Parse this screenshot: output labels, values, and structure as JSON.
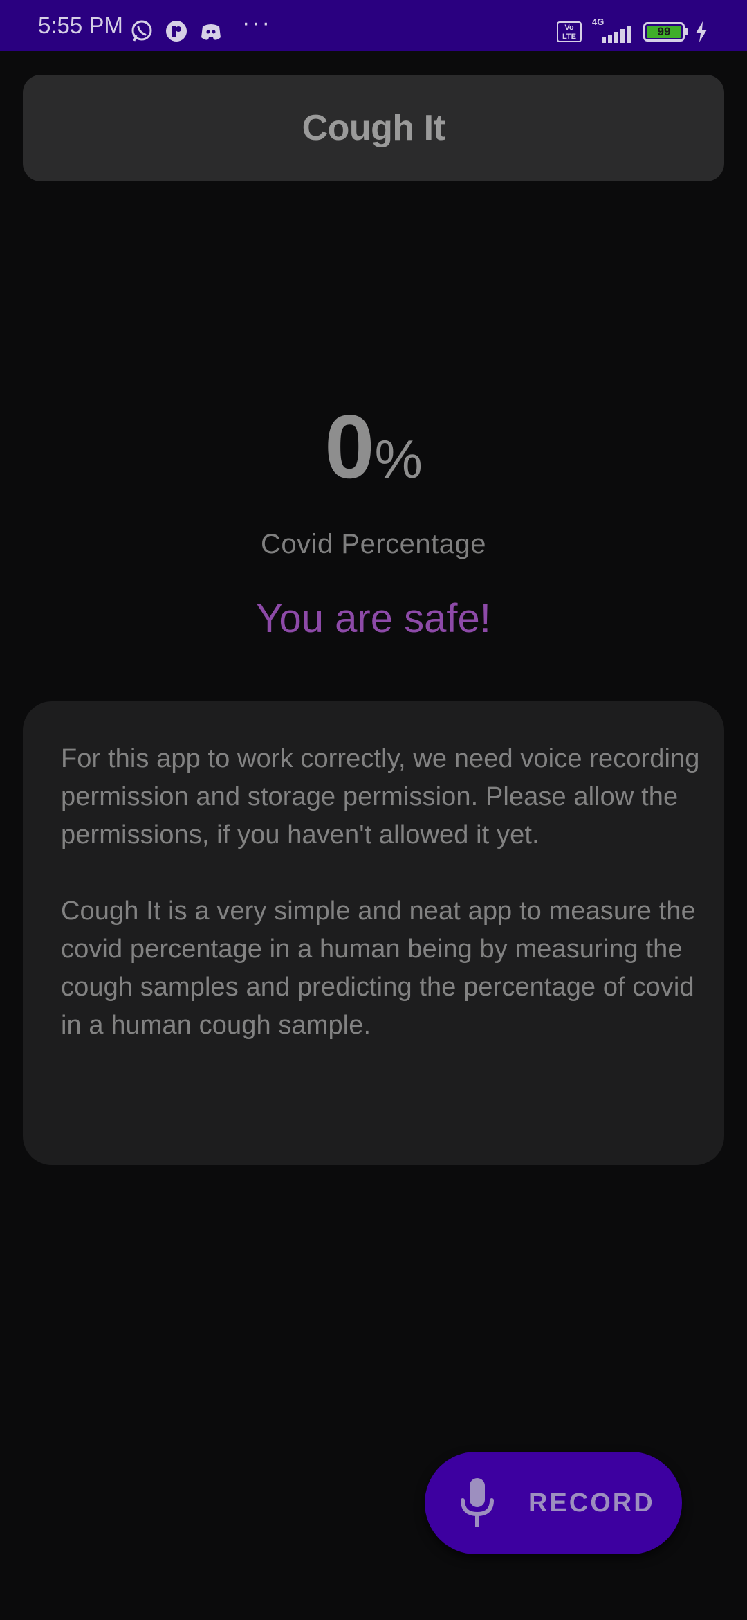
{
  "status_bar": {
    "time": "5:55 PM",
    "more_glyph": "···",
    "volte_label": "Vo\nLTE",
    "network_label": "4G",
    "battery_level": "99",
    "icons": [
      "whatsapp-icon",
      "app-icon",
      "discord-icon",
      "more-icon",
      "volte-icon",
      "signal-icon",
      "battery-icon",
      "charging-bolt-icon"
    ],
    "background_color": "#2a0080"
  },
  "header": {
    "title": "Cough It"
  },
  "result": {
    "percent_value": "0",
    "percent_symbol": "%",
    "label": "Covid Percentage",
    "status": "You are safe!",
    "status_color": "#8d4aa8"
  },
  "info_card": {
    "paragraph_1": "For this app to work correctly, we need voice recording permission and storage permission. Please allow the permissions, if you haven't allowed it yet.",
    "paragraph_2": "Cough It is a very simple and neat app to measure the covid percentage in a human being by measuring the cough samples and predicting the percentage of covid in a human cough sample."
  },
  "record_button": {
    "label": "RECORD",
    "icon": "microphone-icon",
    "color": "#3d00a0"
  }
}
